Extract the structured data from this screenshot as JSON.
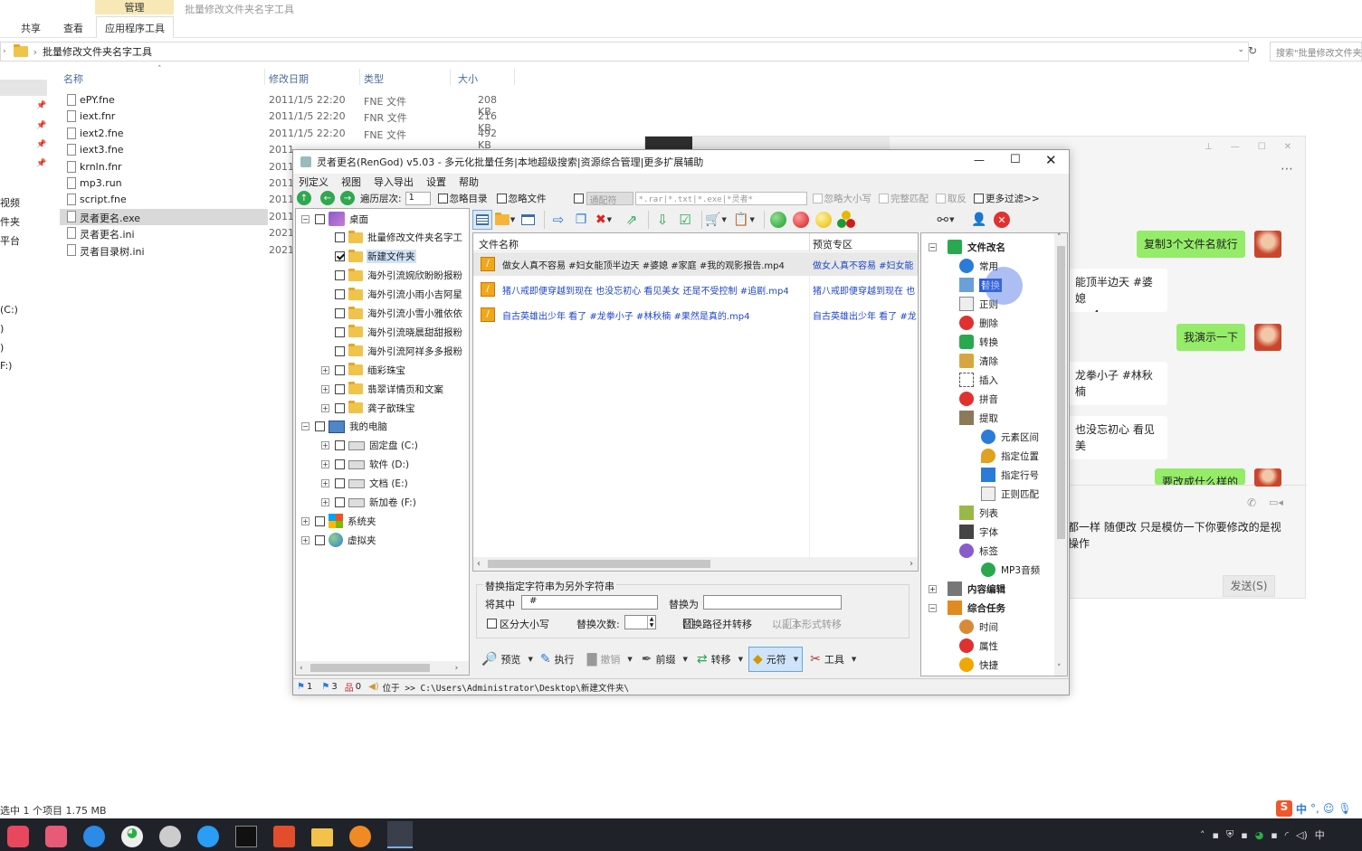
{
  "explorer": {
    "ribbon_tabs": {
      "share": "共享",
      "view": "查看",
      "app_tools": "应用程序工具",
      "manage": "管理"
    },
    "window_title": "批量修改文件夹名字工具",
    "address": "批量修改文件夹名字工具",
    "search_placeholder": "搜索\"批量修改文件夹...",
    "columns": {
      "name": "名称",
      "date": "修改日期",
      "type": "类型",
      "size": "大小"
    },
    "files": [
      {
        "name": "ePY.fne",
        "date": "2011/1/5 22:20",
        "type": "FNE 文件",
        "size": "208 KB"
      },
      {
        "name": "iext.fnr",
        "date": "2011/1/5 22:20",
        "type": "FNR 文件",
        "size": "216 KB"
      },
      {
        "name": "iext2.fne",
        "date": "2011/1/5 22:20",
        "type": "FNE 文件",
        "size": "492 KB"
      },
      {
        "name": "iext3.fne",
        "date": "2011",
        "type": "",
        "size": ""
      },
      {
        "name": "krnln.fnr",
        "date": "2011",
        "type": "",
        "size": ""
      },
      {
        "name": "mp3.run",
        "date": "2011",
        "type": "",
        "size": ""
      },
      {
        "name": "script.fne",
        "date": "2011",
        "type": "",
        "size": ""
      },
      {
        "name": "灵者更名.exe",
        "date": "2011",
        "type": "",
        "size": ""
      },
      {
        "name": "灵者更名.ini",
        "date": "2021",
        "type": "",
        "size": ""
      },
      {
        "name": "灵者目录树.ini",
        "date": "2021",
        "type": "",
        "size": ""
      }
    ],
    "left_nav": [
      "视频",
      "件夹",
      "平台",
      "(C:)",
      ")",
      ")",
      "F:)"
    ],
    "status": "选中 1 个项目  1.75 MB"
  },
  "chat": {
    "messages": [
      {
        "side": "right",
        "text": "复制3个文件名就行"
      },
      {
        "side": "left",
        "text": "能顶半边天 #婆媳\nmp4"
      },
      {
        "side": "right",
        "text": "我演示一下"
      },
      {
        "side": "left",
        "text": "龙拳小子 #林秋楠"
      },
      {
        "side": "left",
        "text": "也没忘初心 看见美"
      },
      {
        "side": "right",
        "text": "要改成什么样的"
      }
    ],
    "input_text": "都一样 随便改 只是模仿一下你要修改的是视\n操作",
    "send": "发送(S)"
  },
  "app": {
    "title": "灵者更名(RenGod) v5.03 - 多元化批量任务|本地超级搜索|资源综合管理|更多扩展辅助",
    "menu": [
      "列定义",
      "视图",
      "导入导出",
      "设置",
      "帮助"
    ],
    "filter": {
      "depth_label": "遍历层次:",
      "depth_value": "1",
      "ignore_dir": "忽略目录",
      "ignore_file": "忽略文件",
      "wildcard": "通配符",
      "pattern": "*.rar|*.txt|*.exe|*灵者*",
      "ignore_case": "忽略大小写",
      "full_match": "完整匹配",
      "invert": "取反",
      "more": "更多过滤>>"
    },
    "tree": [
      {
        "label": "桌面",
        "level": 0,
        "exp": "-",
        "checked": false,
        "icon": "desktop"
      },
      {
        "label": "批量修改文件夹名字工",
        "level": 1,
        "exp": "",
        "checked": false,
        "icon": "folder"
      },
      {
        "label": "新建文件夹",
        "level": 1,
        "exp": "",
        "checked": true,
        "icon": "folder-open",
        "selected": true
      },
      {
        "label": "海外引流婉欣盼盼报粉",
        "level": 1,
        "exp": "",
        "checked": false,
        "icon": "folder"
      },
      {
        "label": "海外引流小雨小吉阿星",
        "level": 1,
        "exp": "",
        "checked": false,
        "icon": "folder"
      },
      {
        "label": "海外引流小雪小雅依依",
        "level": 1,
        "exp": "",
        "checked": false,
        "icon": "folder"
      },
      {
        "label": "海外引流晓晨甜甜报粉",
        "level": 1,
        "exp": "",
        "checked": false,
        "icon": "folder"
      },
      {
        "label": "海外引流阿祥多多报粉",
        "level": 1,
        "exp": "",
        "checked": false,
        "icon": "folder"
      },
      {
        "label": "缅彩珠宝",
        "level": 1,
        "exp": "+",
        "checked": false,
        "icon": "folder"
      },
      {
        "label": "翡翠详情页和文案",
        "level": 1,
        "exp": "+",
        "checked": false,
        "icon": "folder"
      },
      {
        "label": "龚子歆珠宝",
        "level": 1,
        "exp": "+",
        "checked": false,
        "icon": "folder"
      },
      {
        "label": "我的电脑",
        "level": 0,
        "exp": "-",
        "checked": false,
        "icon": "computer"
      },
      {
        "label": "固定盘 (C:)",
        "level": 1,
        "exp": "+",
        "checked": false,
        "icon": "drive"
      },
      {
        "label": "软件 (D:)",
        "level": 1,
        "exp": "+",
        "checked": false,
        "icon": "drive"
      },
      {
        "label": "文档 (E:)",
        "level": 1,
        "exp": "+",
        "checked": false,
        "icon": "drive"
      },
      {
        "label": "新加卷 (F:)",
        "level": 1,
        "exp": "+",
        "checked": false,
        "icon": "drive"
      },
      {
        "label": "系统夹",
        "level": 0,
        "exp": "+",
        "checked": false,
        "icon": "windows"
      },
      {
        "label": "虚拟夹",
        "level": 0,
        "exp": "+",
        "checked": false,
        "icon": "globe"
      }
    ],
    "list_headers": {
      "name": "文件名称",
      "preview": "预览专区"
    },
    "list_rows": [
      {
        "name": "做女人真不容易 #妇女能顶半边天 #婆媳 #家庭 #我的观影报告.mp4",
        "preview": "做女人真不容易 #妇女能"
      },
      {
        "name": "猪八戒即便穿越到现在 也没忘初心 看见美女 还是不受控制 #追剧.mp4",
        "preview": "猪八戒即便穿越到现在 也"
      },
      {
        "name": "自古英雄出少年 看了 #龙拳小子 #林秋楠 #果然是真的.mp4",
        "preview": "自古英雄出少年 看了 #龙"
      }
    ],
    "replace": {
      "title": "替换指定字符串为另外字符串",
      "find_label": "将其中",
      "find_value": "#",
      "replace_label": "替换为",
      "replace_value": "",
      "case": "区分大小写",
      "count_label": "替换次数:",
      "path_label": "替换路径并转移",
      "copy_label": "以副本形式转移"
    },
    "actions": [
      "预览",
      "执行",
      "撤销",
      "前缀",
      "转移",
      "元符",
      "工具"
    ],
    "ops_tree": [
      {
        "label": "文件改名",
        "level": 0,
        "bold": true,
        "icon": "rename"
      },
      {
        "label": "常用",
        "level": 1,
        "icon": "info"
      },
      {
        "label": "替换",
        "level": 1,
        "icon": "replace",
        "selected": true
      },
      {
        "label": "正则",
        "level": 1,
        "icon": "regex"
      },
      {
        "label": "删除",
        "level": 1,
        "icon": "delete"
      },
      {
        "label": "转换",
        "level": 1,
        "icon": "convert"
      },
      {
        "label": "清除",
        "level": 1,
        "icon": "broom"
      },
      {
        "label": "插入",
        "level": 1,
        "icon": "insert"
      },
      {
        "label": "拼音",
        "level": 1,
        "icon": "pinyin"
      },
      {
        "label": "提取",
        "level": 1,
        "icon": "extract"
      },
      {
        "label": "元素区间",
        "level": 2,
        "icon": "range"
      },
      {
        "label": "指定位置",
        "level": 2,
        "icon": "position"
      },
      {
        "label": "指定行号",
        "level": 2,
        "icon": "line"
      },
      {
        "label": "正则匹配",
        "level": 2,
        "icon": "regex"
      },
      {
        "label": "列表",
        "level": 1,
        "icon": "list"
      },
      {
        "label": "字体",
        "level": 1,
        "icon": "font"
      },
      {
        "label": "标签",
        "level": 1,
        "icon": "tag"
      },
      {
        "label": "MP3音频",
        "level": 2,
        "icon": "music"
      },
      {
        "label": "内容编辑",
        "level": 0,
        "bold": true,
        "icon": "edit"
      },
      {
        "label": "综合任务",
        "level": 0,
        "bold": true,
        "icon": "task"
      },
      {
        "label": "时间",
        "level": 1,
        "icon": "clock"
      },
      {
        "label": "属性",
        "level": 1,
        "icon": "attr"
      },
      {
        "label": "快捷",
        "level": 1,
        "icon": "shortcut"
      }
    ],
    "status": {
      "a": "1",
      "b": "3",
      "c": "0",
      "location": "位于 >> C:\\Users\\Administrator\\Desktop\\新建文件夹\\"
    }
  },
  "taskbar": {
    "tray": "中"
  },
  "colors": {
    "accent": "#3f83d6",
    "chat_bubble": "#95ec69",
    "selected": "#cce8ff"
  }
}
